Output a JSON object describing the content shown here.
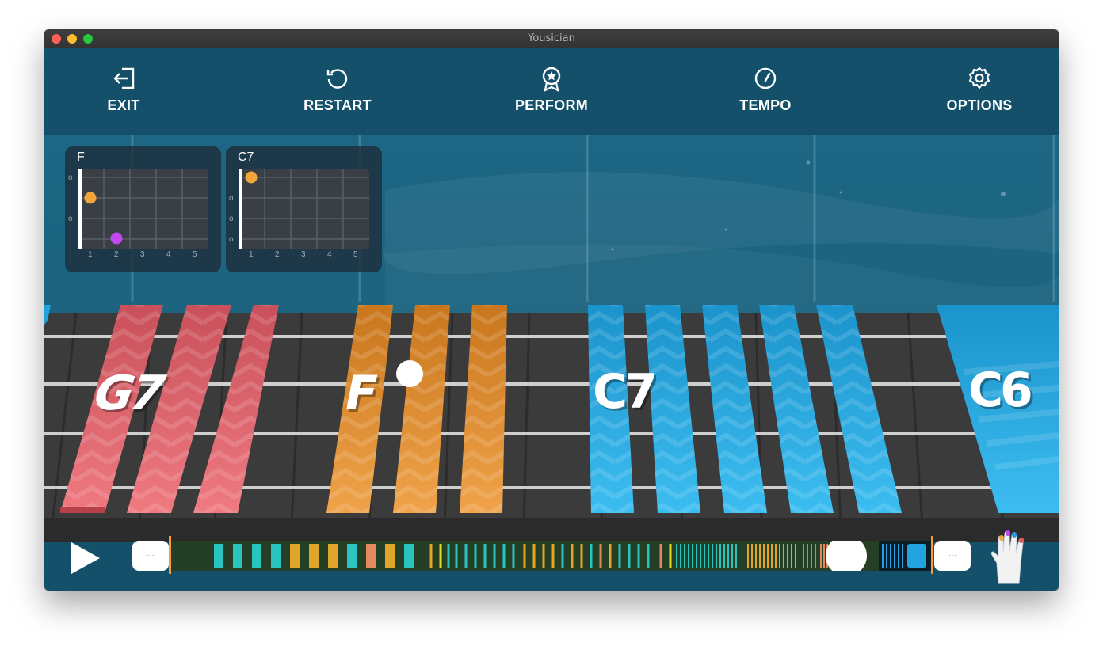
{
  "window": {
    "title": "Yousician"
  },
  "toolbar": {
    "exit": "EXIT",
    "restart": "RESTART",
    "perform": "PERFORM",
    "tempo": "TEMPO",
    "options": "OPTIONS"
  },
  "chords": [
    {
      "name": "F",
      "frets": [
        "1",
        "2",
        "3",
        "4",
        "5"
      ],
      "open": [
        "o",
        "o"
      ]
    },
    {
      "name": "C7",
      "frets": [
        "1",
        "2",
        "3",
        "4",
        "5"
      ],
      "open": [
        "o",
        "o",
        "o"
      ]
    }
  ],
  "lane_labels": [
    "G7",
    "F",
    "C7",
    "C6"
  ],
  "bubbles": {
    "left": "···",
    "right": "···"
  },
  "colors": {
    "red": "#e05a61",
    "orange": "#e48a22",
    "blue": "#22a3dd",
    "teal": "#2bc3c0",
    "finger1": "#f2a53a",
    "finger2": "#c348ef"
  },
  "icons": {
    "exit": "exit-icon",
    "restart": "restart-icon",
    "perform": "perform-icon",
    "tempo": "tempo-icon",
    "options": "gear-icon",
    "play": "play-icon",
    "hand": "hand-icon"
  }
}
